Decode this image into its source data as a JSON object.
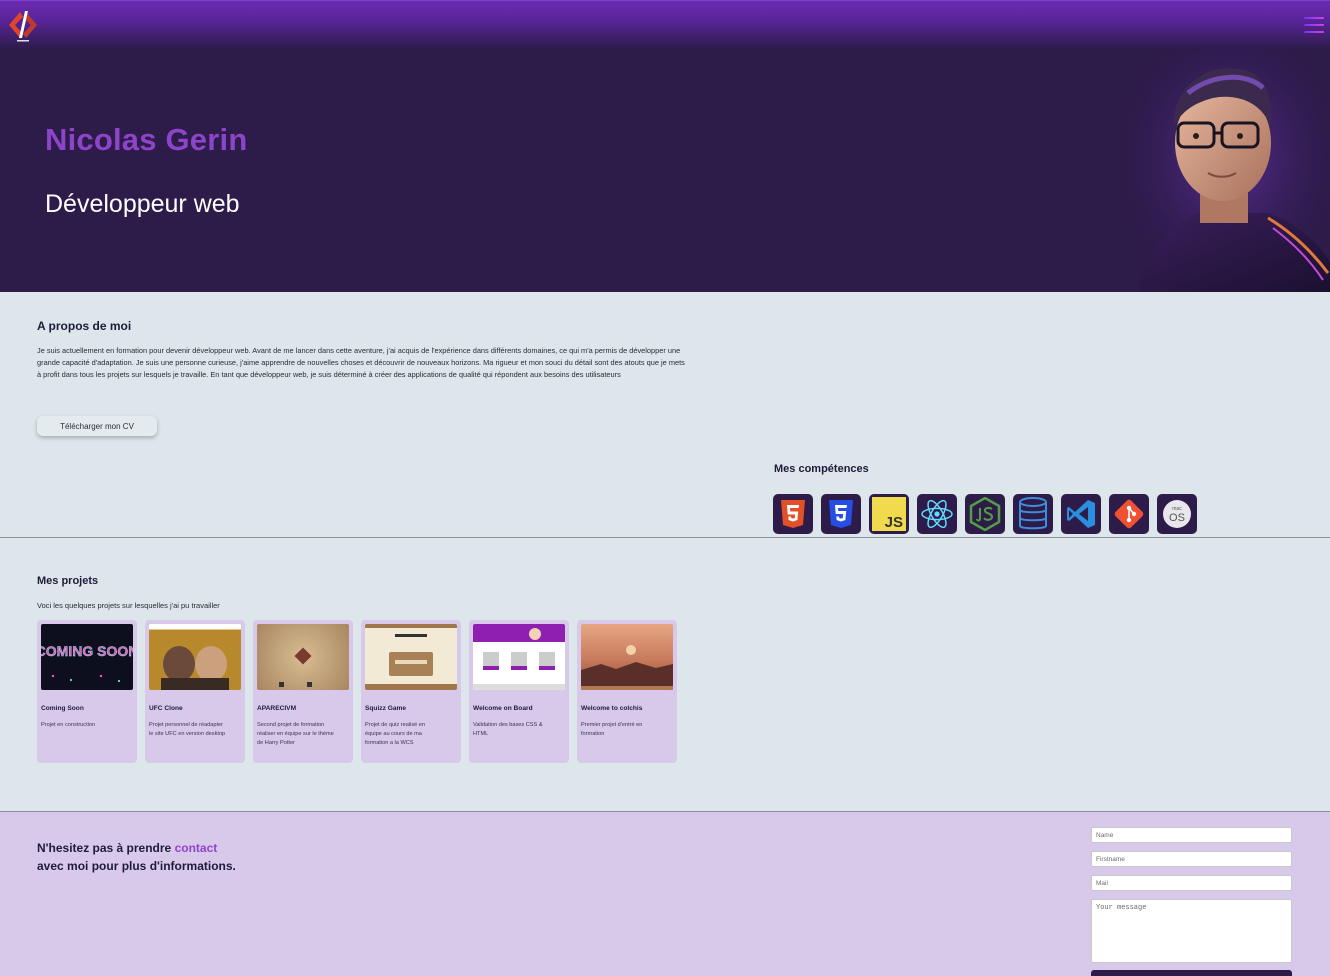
{
  "header": {
    "logo": "code-logo-icon",
    "menu": "hamburger-menu-icon"
  },
  "hero": {
    "name": "Nicolas Gerin",
    "role": "Développeur web",
    "portrait": "developer-portrait"
  },
  "about": {
    "title": "A propos de moi",
    "text": "Je suis actuellement en formation pour devenir développeur web. Avant de me lancer dans cette aventure, j'ai acquis de l'expérience dans différents domaines, ce qui m'a permis de développer une grande capacité d'adaptation. Je suis une personne curieuse, j'aime apprendre de nouvelles choses et découvrir de nouveaux horizons. Ma rigueur et mon souci du détail sont des atouts que je mets à profit dans tous les projets sur lesquels je travaille. En tant que développeur web, je suis déterminé à créer des applications de qualité qui répondent aux besoins des utilisateurs",
    "cv_button": "Télécharger mon CV"
  },
  "skills": {
    "title": "Mes compétences",
    "items": [
      "html5-icon",
      "css3-icon",
      "javascript-icon",
      "react-icon",
      "nodejs-icon",
      "database-icon",
      "vscode-icon",
      "git-icon",
      "macos-icon"
    ],
    "js_label": "JS",
    "os_small": "mac",
    "os_label": "OS"
  },
  "projects": {
    "title": "Mes projets",
    "subtitle": "Voci les quelques projets sur lesquelles j'ai pu travailler",
    "coming_soon_text": "COMING SOON",
    "items": [
      {
        "title": "Coming Soon",
        "desc": "Projet en construction"
      },
      {
        "title": "UFC Clone",
        "desc": "Projet personnel de réadapter le site UFC en version desktop"
      },
      {
        "title": "APARECIVM",
        "desc": "Second projet de formation réaliser en équipe sur le thème de Harry Potter"
      },
      {
        "title": "Squizz Game",
        "desc": "Projet de quiz realisé en équipe au cours de ma formation a la WCS"
      },
      {
        "title": "Welcome on Board",
        "desc": "Validation des bases CSS & HTML"
      },
      {
        "title": "Welcome to colchis",
        "desc": "Premier projet d'entré en formation"
      }
    ]
  },
  "contact": {
    "text_before": "N'hesitez pas à prendre ",
    "link": "contact",
    "text_after": " avec moi pour plus d'informations.",
    "name_placeholder": "Name",
    "firstname_placeholder": "Firstname",
    "mail_placeholder": "Mail",
    "message_placeholder": "Your message"
  },
  "colors": {
    "accent": "#8e44c9",
    "hero_bg": "#2d1b4a",
    "page_bg": "#dde7eb",
    "card_bg": "#d8c9ea"
  }
}
